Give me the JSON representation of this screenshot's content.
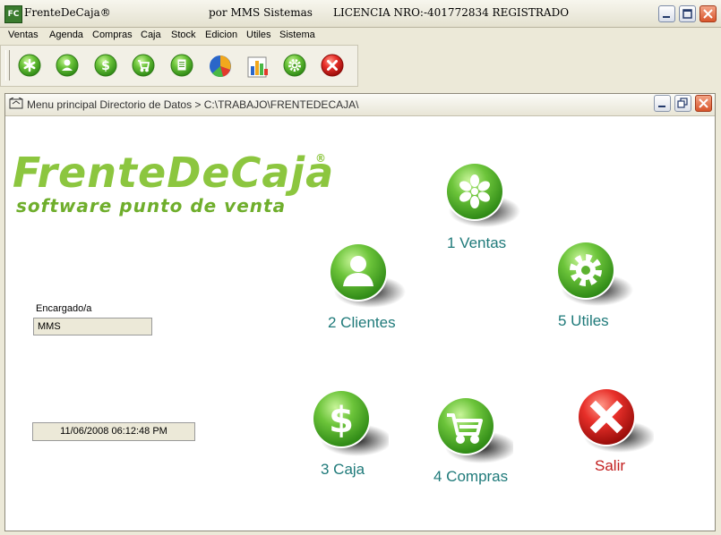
{
  "titlebar": {
    "app_icon": "FC",
    "app_name": "FrenteDeCaja®",
    "by": "por MMS Sistemas",
    "license": "LICENCIA NRO:-401772834 REGISTRADO"
  },
  "menu": [
    "Ventas",
    "Agenda",
    "Compras",
    "Caja",
    "Stock",
    "Edicion",
    "Utiles",
    "Sistema"
  ],
  "toolbar": {
    "icons": [
      "asterisk-icon",
      "user-icon",
      "dollar-icon",
      "cart-icon",
      "document-icon",
      "pie-chart-icon",
      "bar-chart-icon",
      "gear-icon",
      "close-icon"
    ]
  },
  "inner_window": {
    "title": "Menu principal Directorio de Datos > C:\\TRABAJO\\FRENTEDECAJA\\"
  },
  "logo": {
    "main": "FrenteDeCaja",
    "reg": "®",
    "sub": "software punto de venta"
  },
  "encargado": {
    "label": "Encargado/a",
    "value": "MMS"
  },
  "datetime": "11/06/2008 06:12:48 PM",
  "buttons": {
    "ventas": "1 Ventas",
    "clientes": "2 Clientes",
    "utiles": "5  Utiles",
    "caja": "3 Caja",
    "compras": "4  Compras",
    "salir": "Salir"
  },
  "colors": {
    "green": "#6cc43a",
    "red": "#d8201e",
    "teal_label": "#1f7a7a"
  }
}
